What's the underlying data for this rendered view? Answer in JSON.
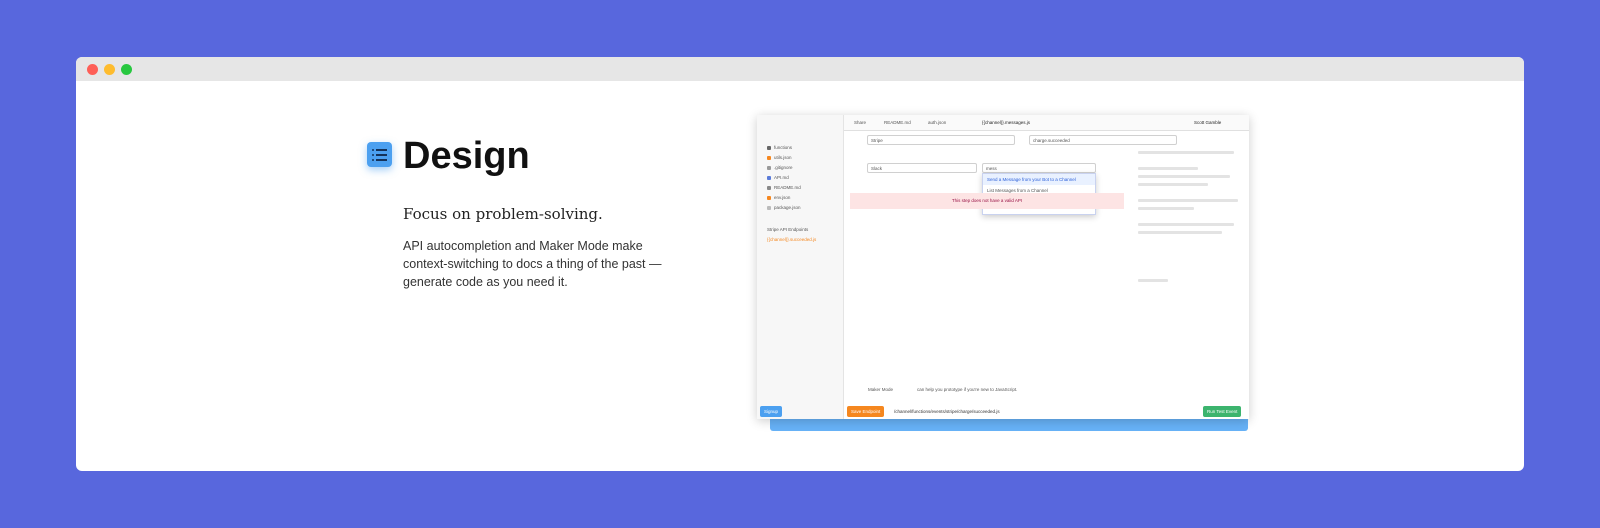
{
  "feature": {
    "icon": "list-icon",
    "title": "Design",
    "subtitle": "Focus on problem-solving.",
    "description": "API autocompletion and Maker Mode make context-switching to docs a thing of the past — generate code as you need it."
  },
  "screenshot": {
    "tabs": [
      "README.md",
      "auth.json",
      "{{channel}}.messages.js"
    ],
    "share_label": "Share",
    "user": "Scott Gamble",
    "sidebar_items": [
      "functions",
      "utils.json",
      ".gitignore",
      "API.md",
      "README.md",
      "env.json",
      "package.json"
    ],
    "sidebar_section": "Stripe API Endpoints",
    "sidebar_active": "{{channel}}.succeeded.js",
    "row1_service": "Stripe",
    "row1_event": "charge.succeeded",
    "row2_service": "Slack",
    "row2_query": "mess",
    "dropdown_items": [
      "Send a Message from your Bot to a Channel",
      "List Messages from a Channel",
      "Send a User a Message from your Bot"
    ],
    "error_text": "This step does not have a valid API",
    "maker_mode": "Maker Mode",
    "bottom_prompt": "can help you prototype if you're new to JavaScript.",
    "save_button": "Save Endpoint",
    "path_text": "/channel/functions/events/stripe/charge/succeeded.js",
    "run_button": "Run Test Event",
    "signup_button": "Signup",
    "payload_label": "Edit Test Event Payload",
    "colors": {
      "accent": "#4ca0f0",
      "orange": "#f5871f",
      "green": "#3cb46e",
      "blue": "#2b5fd9"
    }
  }
}
